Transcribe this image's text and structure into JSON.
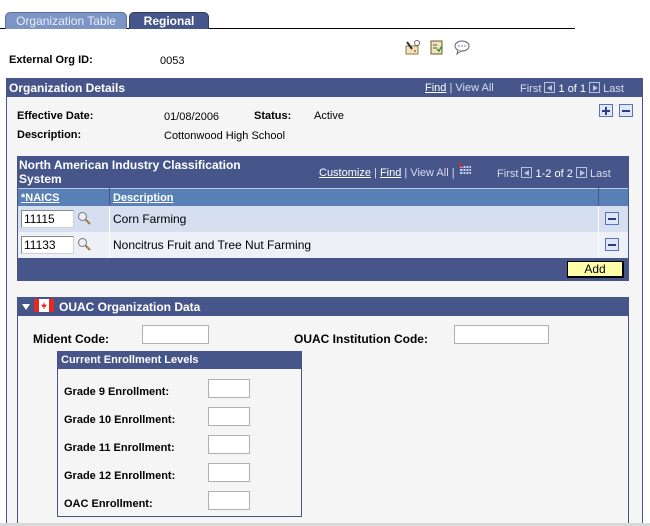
{
  "tabs": [
    {
      "label": "Organization Table",
      "active": false
    },
    {
      "label": "Regional",
      "active": true
    }
  ],
  "external_org": {
    "label": "External Org ID:",
    "value": "0053"
  },
  "toolbar_icons": [
    "send-notification-icon",
    "worklist-icon",
    "comment-icon"
  ],
  "org_details": {
    "title": "Organization Details",
    "nav": {
      "find": "Find",
      "separator": "|",
      "view_all": "View All",
      "first": "First",
      "count": "1 of 1",
      "last": "Last"
    },
    "effective_date_label": "Effective Date:",
    "effective_date": "01/08/2006",
    "status_label": "Status:",
    "status": "Active",
    "description_label": "Description:",
    "description": "Cottonwood High School"
  },
  "naics_grid": {
    "title": "North American Industry Classification System",
    "nav": {
      "customize": "Customize",
      "find": "Find",
      "view_all": "View All",
      "sep": "|",
      "first": "First",
      "count": "1-2 of 2",
      "last": "Last"
    },
    "columns": [
      "*NAICS",
      "Description"
    ],
    "rows": [
      {
        "naics": "11115",
        "description": "Corn Farming"
      },
      {
        "naics": "11133",
        "description": "Noncitrus Fruit and Tree Nut Farming"
      }
    ],
    "add_label": "Add"
  },
  "ouac": {
    "title": "OUAC Organization Data",
    "mident_label": "Mident Code:",
    "mident_value": "",
    "institution_label": "OUAC Institution Code:",
    "institution_value": "",
    "enrollment": {
      "title": "Current Enrollment Levels",
      "fields": [
        {
          "label": "Grade 9 Enrollment:",
          "value": ""
        },
        {
          "label": "Grade 10 Enrollment:",
          "value": ""
        },
        {
          "label": "Grade 11 Enrollment:",
          "value": ""
        },
        {
          "label": "Grade 12 Enrollment:",
          "value": ""
        },
        {
          "label": "OAC Enrollment:",
          "value": ""
        }
      ]
    }
  },
  "colors": {
    "header_blue": "#47568a",
    "column_header_blue": "#5980b4",
    "add_button_yellow": "#ffffa8",
    "canada_red": "#e8281e"
  }
}
